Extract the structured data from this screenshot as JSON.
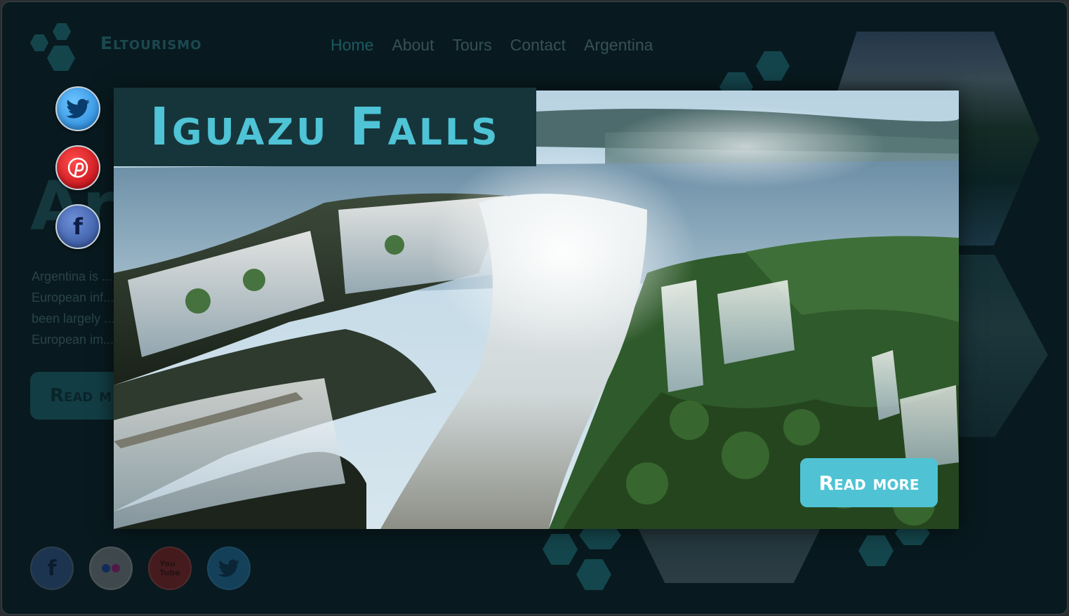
{
  "brand": {
    "name": "Eltourismo"
  },
  "nav": {
    "items": [
      {
        "label": "Home",
        "active": true
      },
      {
        "label": "About",
        "active": false
      },
      {
        "label": "Tours",
        "active": false
      },
      {
        "label": "Contact",
        "active": false
      },
      {
        "label": "Argentina",
        "active": false
      }
    ]
  },
  "background": {
    "title_fragment": "Ar",
    "intro_lines": [
      "Argentina is ...",
      "European inf...",
      "been largely ...",
      "European im..."
    ],
    "read_more_label": "Read m"
  },
  "social_left": [
    {
      "icon": "twitter-icon",
      "color": "#3aa0e8"
    },
    {
      "icon": "pinterest-icon",
      "color": "#d6131c"
    },
    {
      "icon": "facebook-icon",
      "color": "#3b5fae"
    }
  ],
  "social_bottom": [
    {
      "icon": "facebook-icon",
      "color": "#2f4a7a"
    },
    {
      "icon": "flickr-icon",
      "color": "#6c6f73"
    },
    {
      "icon": "youtube-icon",
      "color": "#7a1d1d"
    },
    {
      "icon": "twitter-icon",
      "color": "#1f5f8a"
    }
  ],
  "modal": {
    "title": "Iguazu Falls",
    "read_more_label": "Read more",
    "image": "iguazu-falls-photo"
  },
  "colors": {
    "accent": "#4fc3d4",
    "title_bg": "#16353a",
    "page_bg": "#081a1f"
  }
}
